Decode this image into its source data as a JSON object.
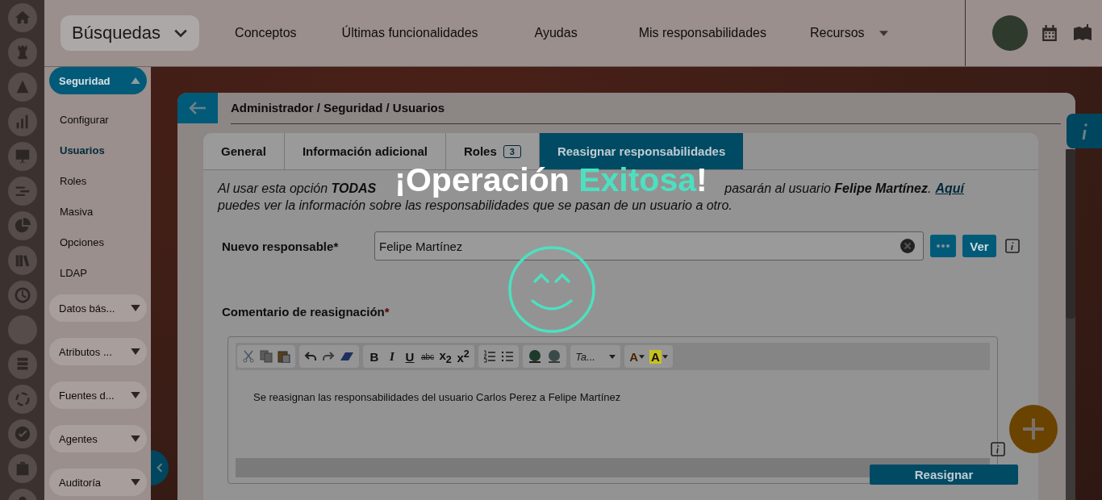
{
  "top_bar": {
    "search_dropdown": "Búsquedas",
    "nav": [
      "Conceptos",
      "Últimas funcionalidades",
      "Ayudas",
      "Mis responsabilidades",
      "Recursos"
    ]
  },
  "sidebar": {
    "sections": [
      {
        "label": "Seguridad",
        "expanded": true,
        "items": [
          {
            "label": "Configurar",
            "selected": false
          },
          {
            "label": "Usuarios",
            "selected": true
          },
          {
            "label": "Roles",
            "selected": false
          },
          {
            "label": "Masiva",
            "selected": false
          },
          {
            "label": "Opciones",
            "selected": false
          },
          {
            "label": "LDAP",
            "selected": false
          }
        ]
      },
      {
        "label": "Datos bás...",
        "expanded": false
      },
      {
        "label": "Atributos ...",
        "expanded": false
      },
      {
        "label": "Fuentes d...",
        "expanded": false
      },
      {
        "label": "Agentes",
        "expanded": false
      },
      {
        "label": "Auditoría",
        "expanded": false
      }
    ]
  },
  "breadcrumb": "Administrador / Seguridad / Usuarios",
  "tabs": [
    {
      "label": "General",
      "selected": false
    },
    {
      "label": "Información adicional",
      "selected": false
    },
    {
      "label": "Roles",
      "badge": "3",
      "selected": false
    },
    {
      "label": "Reasignar responsabilidades",
      "selected": true
    }
  ],
  "notice": {
    "start": "Al usar esta opción **TODAS**",
    "end": "pasarán al usuario **Felipe Martínez**.",
    "link": "Aquí",
    "line_2": "puedes ver la información sobre las responsabilidades que se pasan de un usuario a otro."
  },
  "new_owner": {
    "label": "Nuevo responsable*",
    "value": "Felipe Martínez",
    "view_button": "Ver"
  },
  "comment": {
    "label": "Comentario de reasignación",
    "required_mark": "*",
    "format_buttons": [
      "B",
      "I",
      "U",
      "abc",
      "x$_{2}$",
      "x$^{2}$"
    ],
    "style_dropdown": "Ta...",
    "color_buttons": [
      "A",
      "A"
    ],
    "text": "Se reasignan las responsabilidades del usuario Carlos Perez a Felipe Martínez"
  },
  "submit": "Reasignar",
  "toast": {
    "title": "¡Operación **Exitosa**!"
  }
}
